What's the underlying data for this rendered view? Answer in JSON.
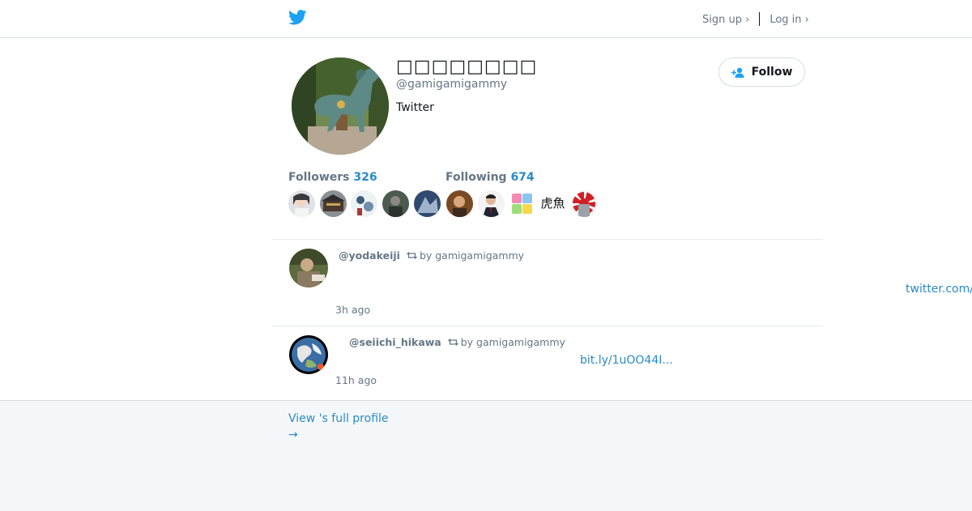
{
  "header": {
    "logo_icon": "twitter-bird-icon",
    "signup_label": "Sign up ›",
    "login_label": "Log in ›"
  },
  "profile": {
    "display_name": "□□□□□□□□",
    "handle": "@gamigamigammy",
    "bio": "Twitter",
    "follow_label": "Follow",
    "followers_label": "Followers",
    "followers_count": "326",
    "following_label": "Following",
    "following_count": "674"
  },
  "mini_avatars": {
    "followers": [
      "avatar-1",
      "avatar-2",
      "avatar-3",
      "avatar-4",
      "avatar-5"
    ],
    "following": [
      "avatar-6",
      "avatar-7",
      "avatar-8",
      "avatar-9",
      "avatar-10"
    ],
    "kanji_avatar_text": "虎魚"
  },
  "tweets": [
    {
      "user": "@yodakeiji",
      "by_label": "by gamigamigammy",
      "link": "twitter.com/",
      "time": "3h ago"
    },
    {
      "user": "@seiichi_hikawa",
      "by_label": "by gamigamigammy",
      "link": "bit.ly/1uOO44I...",
      "time": "11h ago"
    }
  ],
  "footer": {
    "full_profile_label": "View 's full profile",
    "arrow": "→"
  },
  "colors": {
    "link": "#2b8ac6",
    "brand": "#1da1f2",
    "muted": "#657786",
    "footer_bg": "#f5f8fa"
  }
}
